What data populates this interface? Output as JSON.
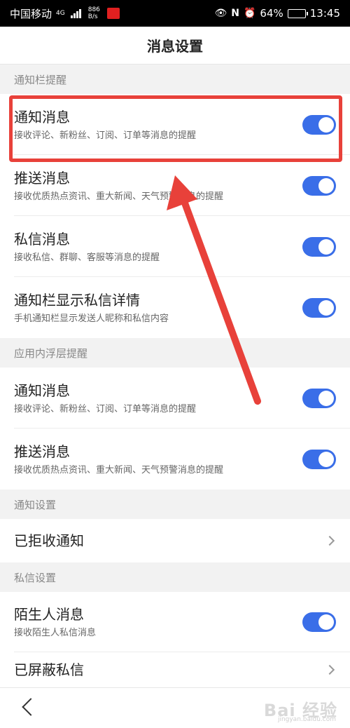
{
  "status_bar": {
    "carrier": "中国移动",
    "net_type": "4G",
    "speed_value": "886",
    "speed_unit": "B/s",
    "battery": "64%",
    "time": "13:45",
    "battery_fill_fraction": 0.64
  },
  "header": {
    "title": "消息设置"
  },
  "sections": {
    "s1": {
      "label": "通知栏提醒"
    },
    "s2": {
      "label": "应用内浮层提醒"
    },
    "s3": {
      "label": "通知设置"
    },
    "s4": {
      "label": "私信设置"
    }
  },
  "rows": {
    "r1": {
      "title": "通知消息",
      "subtitle": "接收评论、新粉丝、订阅、订单等消息的提醒",
      "on": true
    },
    "r2": {
      "title": "推送消息",
      "subtitle": "接收优质热点资讯、重大新闻、天气预警消息的提醒",
      "on": true
    },
    "r3": {
      "title": "私信消息",
      "subtitle": "接收私信、群聊、客服等消息的提醒",
      "on": true
    },
    "r4": {
      "title": "通知栏显示私信详情",
      "subtitle": "手机通知栏显示发送人昵称和私信内容",
      "on": true
    },
    "r5": {
      "title": "通知消息",
      "subtitle": "接收评论、新粉丝、订阅、订单等消息的提醒",
      "on": true
    },
    "r6": {
      "title": "推送消息",
      "subtitle": "接收优质热点资讯、重大新闻、天气预警消息的提醒",
      "on": true
    },
    "r7": {
      "title": "已拒收通知"
    },
    "r8": {
      "title": "陌生人消息",
      "subtitle": "接收陌生人私信消息",
      "on": true
    },
    "r9": {
      "title": "已屏蔽私信"
    }
  },
  "watermark": {
    "text": "Bai 经验",
    "sub": "jingyan.baidu.com"
  },
  "colors": {
    "toggle_on": "#3a6ee8",
    "highlight": "#e8413a",
    "section_bg": "#f2f2f2"
  }
}
